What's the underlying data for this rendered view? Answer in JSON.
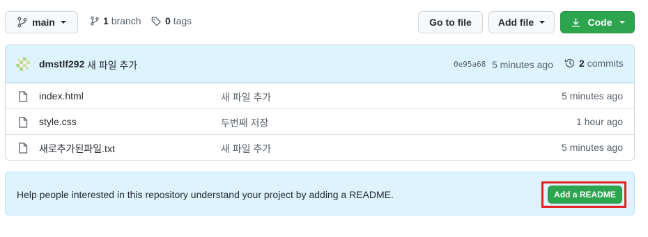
{
  "branch_selector": {
    "label": "main",
    "icon": "git-branch-icon"
  },
  "branches": {
    "count": "1",
    "label": "branch",
    "icon": "git-branch-icon"
  },
  "tags": {
    "count": "0",
    "label": "tags",
    "icon": "tag-icon"
  },
  "actions": {
    "go_to_file": "Go to file",
    "add_file": "Add file",
    "code": "Code",
    "code_icon": "download-icon"
  },
  "latest_commit": {
    "author": "dmstlf292",
    "message": "새 파일 추가",
    "sha": "0e95a68",
    "time": "5 minutes ago",
    "commits_count": "2",
    "commits_label": "commits",
    "history_icon": "history-icon"
  },
  "files": [
    {
      "name": "index.html",
      "message": "새 파일 추가",
      "time": "5 minutes ago",
      "icon": "file-icon"
    },
    {
      "name": "style.css",
      "message": "두번째 저장",
      "time": "1 hour ago",
      "icon": "file-icon"
    },
    {
      "name": "새로추가된파일.txt",
      "message": "새 파일 추가",
      "time": "5 minutes ago",
      "icon": "file-icon"
    }
  ],
  "readme_banner": {
    "text": "Help people interested in this repository understand your project by adding a README.",
    "button": "Add a README",
    "highlight_color": "#e5201f"
  },
  "colors": {
    "primary_green": "#2da44e",
    "info_blue_bg": "#ddf4ff",
    "border": "#d0d7de",
    "muted_text": "#57606a"
  }
}
